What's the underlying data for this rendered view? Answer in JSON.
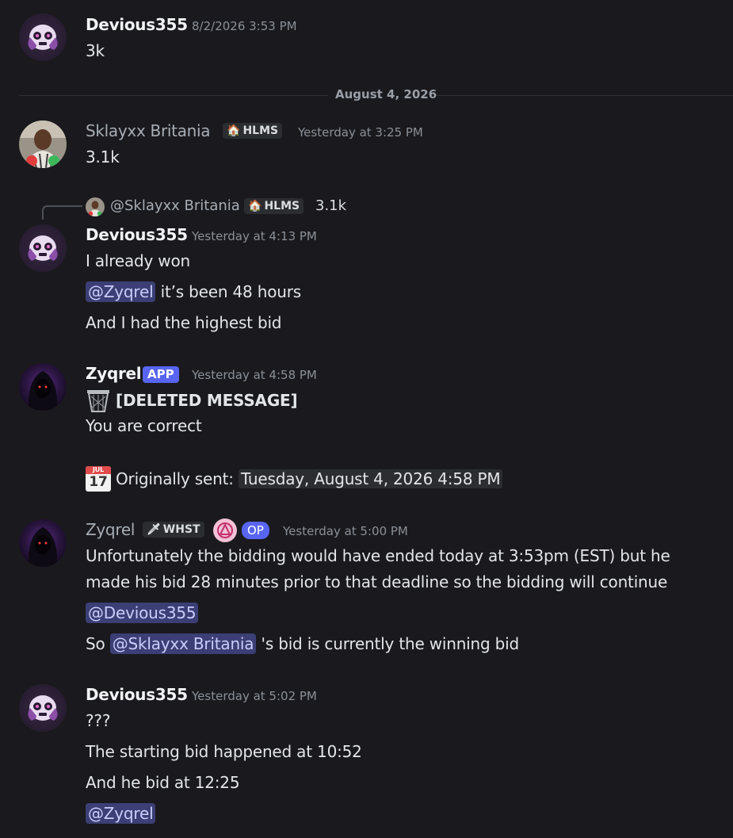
{
  "messages": {
    "m1": {
      "author": "Devious355",
      "timestamp": "8/2/2026 3:53 PM",
      "line1": "3k"
    },
    "divider": "August 4, 2026",
    "m2": {
      "author": "Sklayxx Britania",
      "tag": "HLMS",
      "timestamp": "Yesterday at 3:25 PM",
      "line1": "3.1k"
    },
    "reply": {
      "mention": "@Sklayxx Britania",
      "tag": "HLMS",
      "text": "3.1k"
    },
    "m3": {
      "author": "Devious355",
      "timestamp": "Yesterday at 4:13 PM",
      "line1": "I already won",
      "mention": "@Zyqrel",
      "line2_rest": " it’s been 48 hours",
      "line3": "And I had the highest bid"
    },
    "m4": {
      "author": "Zyqrel",
      "badge": "APP",
      "timestamp": "Yesterday at 4:58 PM",
      "deleted": "[DELETED MESSAGE]",
      "line1": "You are correct",
      "calendar_month": "JUL",
      "calendar_day": "17",
      "orig_label": "Originally sent: ",
      "orig_time": "Tuesday, August 4, 2026 4:58 PM"
    },
    "m5": {
      "author": "Zyqrel",
      "tag": "WHST",
      "badge": "OP",
      "timestamp": "Yesterday at 5:00 PM",
      "line1": "Unfortunately the bidding would have ended today at 3:53pm (EST) but he",
      "line2": "made his bid 28 minutes prior to that deadline so the bidding will continue",
      "mention1": "@Devious355",
      "line4_pre": "So ",
      "mention2": "@Sklayxx Britania",
      "line4_post": " 's bid is currently the winning bid"
    },
    "m6": {
      "author": "Devious355",
      "timestamp": "Yesterday at 5:02 PM",
      "line1": "???",
      "line2": "The starting bid happened at 10:52",
      "line3": "And he bid at 12:25",
      "mention": "@Zyqrel"
    }
  },
  "colors": {
    "background": "#1a1a1e",
    "mention_bg": "#3b3f75",
    "mention_fg": "#c9cdfb",
    "badge": "#5865f2"
  },
  "icons": [
    "ghost-avatar-icon",
    "person-avatar-icon",
    "hooded-avatar-icon",
    "trash-bin-icon",
    "calendar-icon",
    "sword-icon",
    "house-icon",
    "op-role-icon"
  ]
}
